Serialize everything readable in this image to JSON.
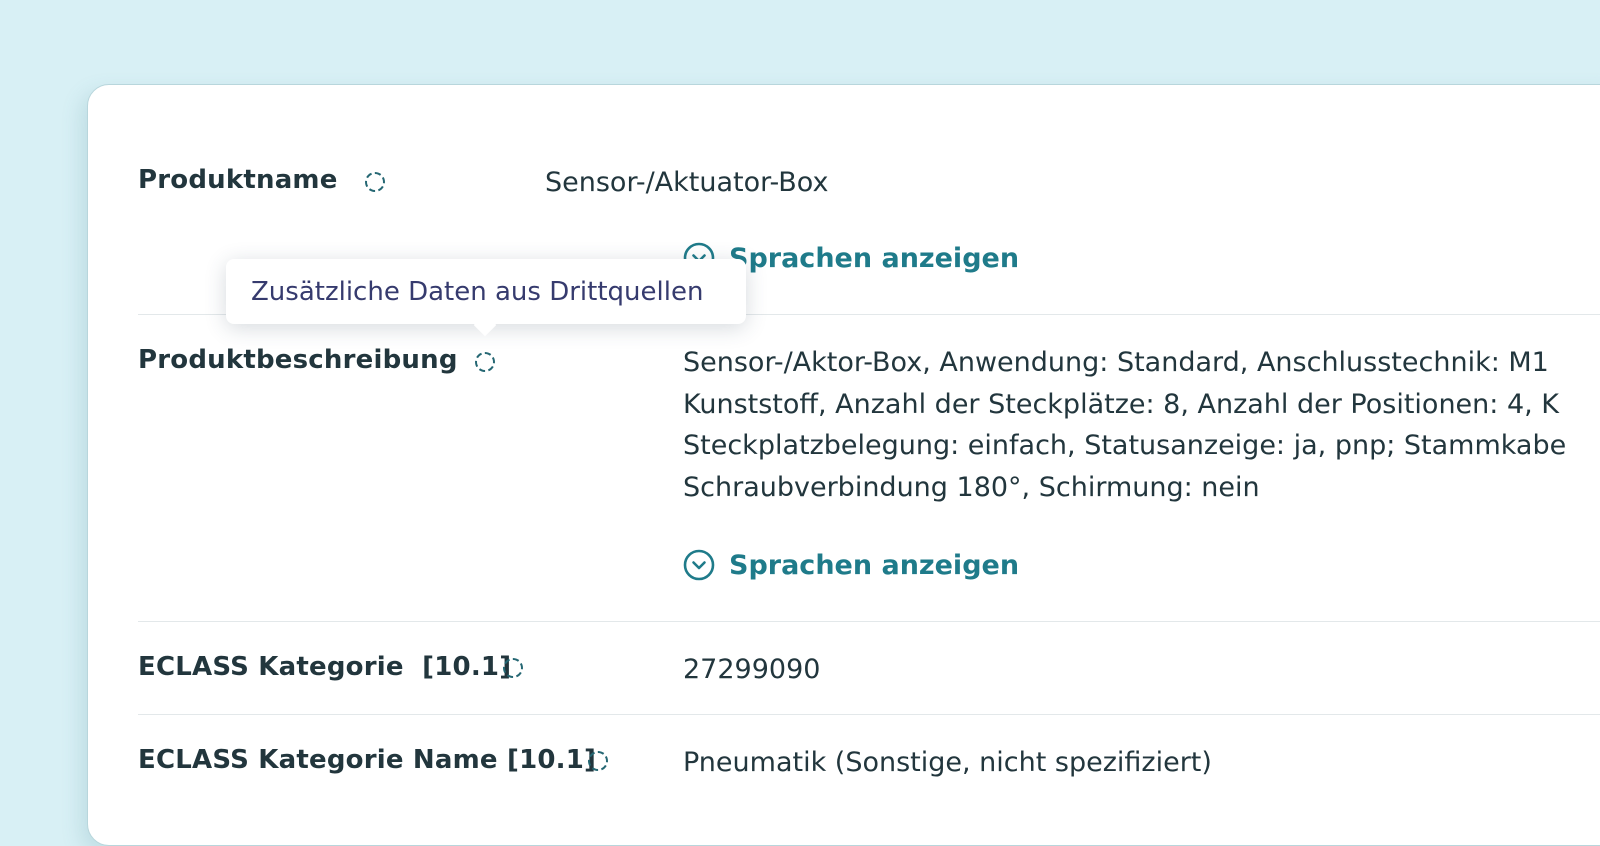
{
  "tooltip": {
    "text": "Zusätzliche Daten aus Drittquellen"
  },
  "rows": [
    {
      "label": "Produktname",
      "value_lines": [
        "Sensor-/Aktuator-Box"
      ],
      "link": "Sprachen anzeigen"
    },
    {
      "label": "Produktbeschreibung",
      "value_lines": [
        "Sensor-/Aktor-Box, Anwendung: Standard, Anschlusstechnik: M1",
        "Kunststoff, Anzahl der Steckplätze: 8, Anzahl der Positionen: 4, K",
        "Steckplatzbelegung: einfach, Statusanzeige: ja, pnp; Stammkabe",
        "Schraubverbindung 180°, Schirmung: nein"
      ],
      "link": "Sprachen anzeigen"
    },
    {
      "label": "ECLASS Kategorie  [10.1]",
      "value_lines": [
        "27299090"
      ]
    },
    {
      "label": "ECLASS Kategorie Name [10.1]",
      "value_lines": [
        "Pneumatik (Sonstige, nicht spezifiziert)"
      ]
    }
  ],
  "icons": {
    "source_indicator": "dashed-circle-icon",
    "expand": "chevron-down-circle-icon"
  },
  "colors": {
    "background": "#d8f0f5",
    "card": "#ffffff",
    "label": "#22363d",
    "link": "#1f7b8a",
    "tooltip_text": "#363b6e"
  }
}
